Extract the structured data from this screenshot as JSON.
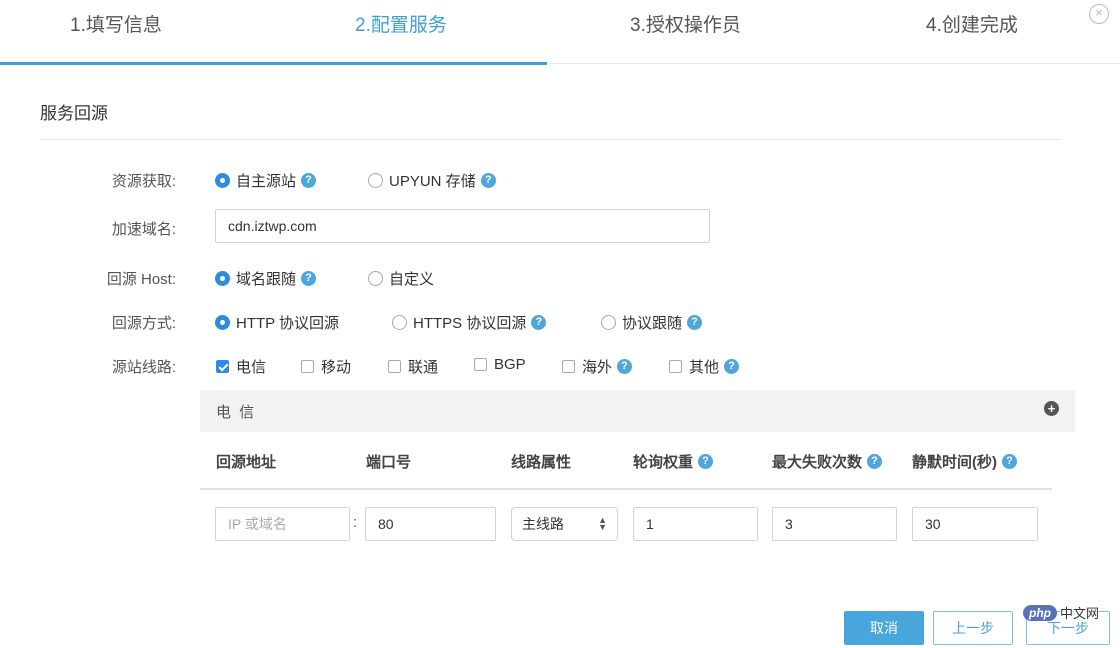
{
  "steps": [
    {
      "label": "1.填写信息",
      "state": "done"
    },
    {
      "label": "2.配置服务",
      "state": "active"
    },
    {
      "label": "3.授权操作员",
      "state": "pending"
    },
    {
      "label": "4.创建完成",
      "state": "pending"
    }
  ],
  "section_title": "服务回源",
  "resource": {
    "label": "资源获取:",
    "options": [
      "自主源站",
      "UPYUN 存储"
    ],
    "selected": "自主源站"
  },
  "domain": {
    "label": "加速域名:",
    "value": "cdn.iztwp.com"
  },
  "host": {
    "label": "回源 Host:",
    "options": [
      "域名跟随",
      "自定义"
    ],
    "selected": "域名跟随"
  },
  "method": {
    "label": "回源方式:",
    "options": [
      "HTTP 协议回源",
      "HTTPS 协议回源",
      "协议跟随"
    ],
    "selected": "HTTP 协议回源"
  },
  "lines": {
    "label": "源站线路:",
    "options": [
      "电信",
      "移动",
      "联通",
      "BGP",
      "海外",
      "其他"
    ],
    "checked": [
      "电信"
    ]
  },
  "panel": {
    "title": "电 信",
    "columns": [
      "回源地址",
      "端口号",
      "线路属性",
      "轮询权重",
      "最大失败次数",
      "静默时间(秒)"
    ],
    "row": {
      "address_placeholder": "IP 或域名",
      "separator": ":",
      "port": "80",
      "line_type": "主线路",
      "weight": "1",
      "max_fails": "3",
      "silence": "30"
    }
  },
  "footer": {
    "cancel": "取消",
    "prev": "上一步",
    "next": "下一步"
  },
  "watermark": {
    "brand": "php",
    "text": "中文网"
  },
  "icons": {
    "help": "question-circle-icon",
    "add": "plus-circle-icon",
    "close": "close-circle-icon",
    "select_arrows": "sort-arrows-icon"
  },
  "colors": {
    "accent": "#3f9fd6",
    "primary_button": "#49a6dc",
    "checked": "#2d8ce0"
  }
}
